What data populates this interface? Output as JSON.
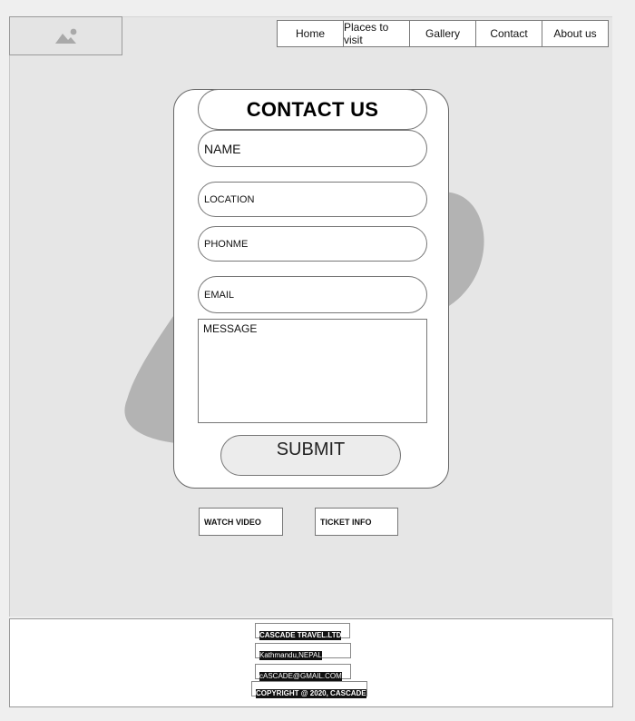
{
  "logo": {
    "icon": "image-placeholder-icon"
  },
  "nav": {
    "items": [
      "Home",
      "Places to visit",
      "Gallery",
      "Contact",
      "About us"
    ]
  },
  "form": {
    "title": "CONTACT US",
    "name_placeholder": "NAME",
    "location_placeholder": "LOCATION",
    "phone_placeholder": "PHONME",
    "email_placeholder": "EMAIL",
    "message_placeholder": "MESSAGE",
    "submit_label": "SUBMIT"
  },
  "actions": {
    "watch_video": "WATCH VIDEO",
    "ticket_info": "TICKET INFO"
  },
  "footer": {
    "company": "CASCADE TRAVEL.LTD",
    "address": "Kathmandu,NEPAL",
    "email": "cASCADE@GMAIL.COM",
    "copyright": "COPYRIGHT @ 2020, CASCADE"
  },
  "colors": {
    "canvas": "#e6e6e6",
    "blob": "#b3b3b3",
    "card": "#ffffff",
    "footer_text_bg": "#111111"
  }
}
